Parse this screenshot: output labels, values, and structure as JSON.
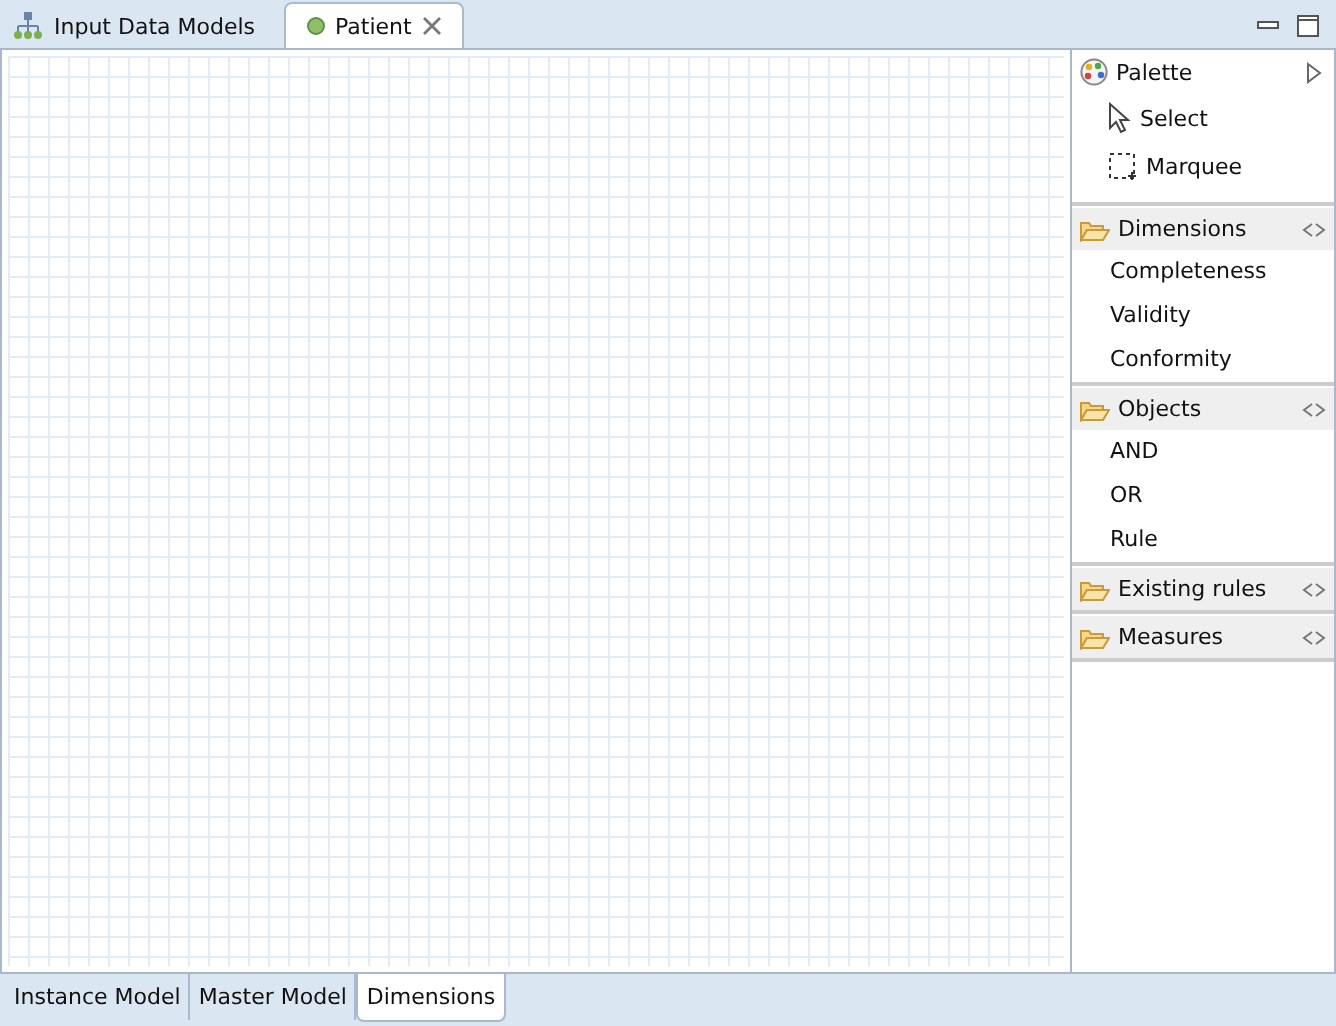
{
  "editor_tabs": [
    {
      "label": "Input Data Models",
      "selected": false
    },
    {
      "label": "Patient",
      "selected": true
    }
  ],
  "palette": {
    "title": "Palette",
    "tools": [
      {
        "label": "Select",
        "kind": "select"
      },
      {
        "label": "Marquee",
        "kind": "marquee"
      }
    ],
    "drawers": [
      {
        "label": "Dimensions",
        "items": [
          "Completeness",
          "Validity",
          "Conformity"
        ]
      },
      {
        "label": "Objects",
        "items": [
          "AND",
          "OR",
          "Rule"
        ]
      },
      {
        "label": "Existing rules"
      },
      {
        "label": "Measures"
      }
    ]
  },
  "page_tabs": [
    {
      "label": "Instance Model",
      "selected": false
    },
    {
      "label": "Master Model",
      "selected": false
    },
    {
      "label": "Dimensions",
      "selected": true
    }
  ]
}
